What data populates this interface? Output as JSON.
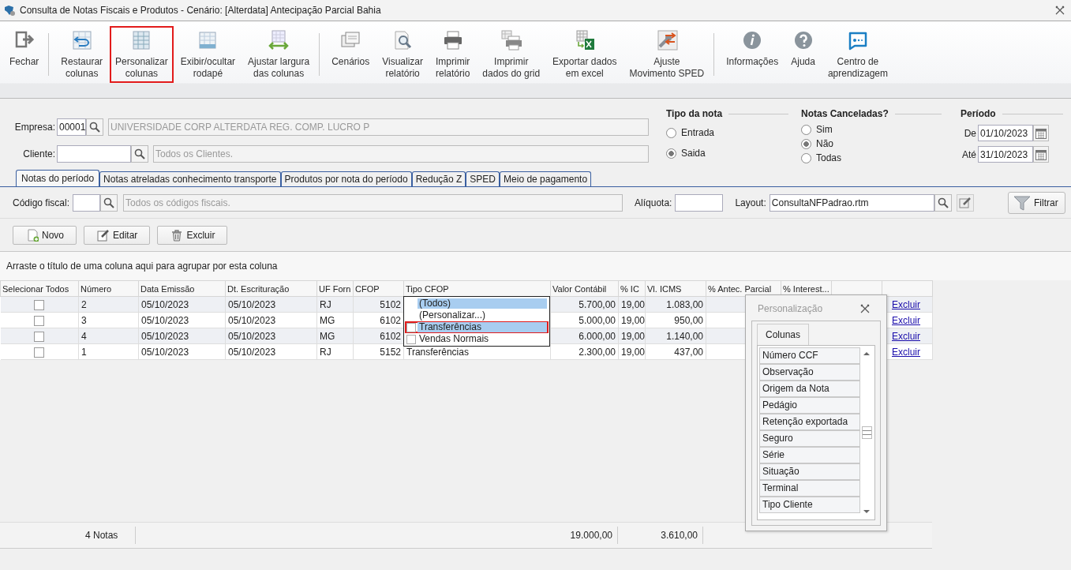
{
  "window": {
    "title": "Consulta de Notas Fiscais e Produtos - Cenário: [Alterdata] Antecipação Parcial Bahia"
  },
  "toolbar": [
    {
      "label": "Fechar",
      "highlighted": false,
      "separator_after": true
    },
    {
      "label": "Restaurar\ncolunas",
      "highlighted": false,
      "separator_after": false
    },
    {
      "label": "Personalizar\ncolunas",
      "highlighted": true,
      "separator_after": false
    },
    {
      "label": "Exibir/ocultar\nrodapé",
      "highlighted": false,
      "separator_after": false
    },
    {
      "label": "Ajustar largura\ndas colunas",
      "highlighted": false,
      "separator_after": true
    },
    {
      "label": "Cenários",
      "highlighted": false,
      "separator_after": false
    },
    {
      "label": "Visualizar\nrelatório",
      "highlighted": false,
      "separator_after": false
    },
    {
      "label": "Imprimir\nrelatório",
      "highlighted": false,
      "separator_after": false
    },
    {
      "label": "Imprimir\ndados do grid",
      "highlighted": false,
      "separator_after": false
    },
    {
      "label": "Exportar dados\nem excel",
      "highlighted": false,
      "separator_after": false
    },
    {
      "label": "Ajuste\nMovimento SPED",
      "highlighted": false,
      "separator_after": true
    },
    {
      "label": "Informações",
      "highlighted": false,
      "separator_after": false
    },
    {
      "label": "Ajuda",
      "highlighted": false,
      "separator_after": false
    },
    {
      "label": "Centro de\naprendizagem",
      "highlighted": false,
      "separator_after": false
    }
  ],
  "empresa": {
    "label": "Empresa:",
    "code": "00001",
    "name": "UNIVERSIDADE CORP ALTERDATA REG. COMP. LUCRO P"
  },
  "cliente": {
    "label": "Cliente:",
    "placeholder": "Todos os Clientes."
  },
  "tipo_da_nota": {
    "title": "Tipo da nota",
    "options": [
      {
        "label": "Entrada",
        "selected": false
      },
      {
        "label": "Saida",
        "selected": true
      }
    ]
  },
  "notas_canceladas": {
    "title": "Notas Canceladas?",
    "options": [
      {
        "label": "Sim",
        "selected": false
      },
      {
        "label": "Não",
        "selected": true
      },
      {
        "label": "Todas",
        "selected": false
      }
    ]
  },
  "periodo": {
    "title": "Período",
    "dates": [
      {
        "label": "De",
        "value": "01/10/2023"
      },
      {
        "label": "Até",
        "value": "31/10/2023"
      }
    ]
  },
  "tabs": [
    {
      "label": "Notas do período",
      "selected": true
    },
    {
      "label": "Notas atreladas conhecimento transporte",
      "selected": false
    },
    {
      "label": "Produtos por nota do período",
      "selected": false
    },
    {
      "label": "Redução Z",
      "selected": false
    },
    {
      "label": "SPED",
      "selected": false
    },
    {
      "label": "Meio de pagamento",
      "selected": false
    }
  ],
  "codigo_fiscal": {
    "label": "Código fiscal:",
    "placeholder": "Todos os códigos fiscais."
  },
  "aliquota": {
    "label": "Alíquota:"
  },
  "layout": {
    "label": "Layout:",
    "value": "ConsultaNFPadrao.rtm"
  },
  "filter_button": "Filtrar",
  "actions": [
    "Novo",
    "Editar",
    "Excluir"
  ],
  "group_hint": "Arraste o título de uma coluna aqui para agrupar por esta coluna",
  "table": {
    "columns": [
      "Selecionar Todos",
      "Número",
      "Data Emissão",
      "Dt. Escrituração",
      "UF Forn",
      "CFOP",
      "Tipo CFOP",
      "Valor Contábil",
      "% IC",
      "Vl. ICMS",
      "% Antec. Parcial",
      "% Interest..."
    ],
    "rows": [
      {
        "checked": false,
        "numero": "2",
        "data_emissao": "05/10/2023",
        "dt_escrituracao": "05/10/2023",
        "uf": "RJ",
        "cfop": "5102",
        "valor_contabil": "5.700,00",
        "pct_icms": "19,00",
        "vl_icms": "1.083,00",
        "action": "Excluir"
      },
      {
        "checked": false,
        "numero": "3",
        "data_emissao": "05/10/2023",
        "dt_escrituracao": "05/10/2023",
        "uf": "MG",
        "cfop": "6102",
        "valor_contabil": "5.000,00",
        "pct_icms": "19,00",
        "vl_icms": "950,00",
        "action": "Excluir"
      },
      {
        "checked": false,
        "numero": "4",
        "data_emissao": "05/10/2023",
        "dt_escrituracao": "05/10/2023",
        "uf": "MG",
        "cfop": "6102",
        "valor_contabil": "6.000,00",
        "pct_icms": "19,00",
        "vl_icms": "1.140,00",
        "action": "Excluir"
      },
      {
        "checked": false,
        "numero": "1",
        "data_emissao": "05/10/2023",
        "dt_escrituracao": "05/10/2023",
        "uf": "RJ",
        "cfop": "5152",
        "tipo_cfop": "Transferências",
        "valor_contabil": "2.300,00",
        "pct_icms": "19,00",
        "vl_icms": "437,00",
        "action": "Excluir"
      }
    ],
    "footer": {
      "count": "4 Notas",
      "valor_contabil": "19.000,00",
      "vl_icms": "3.610,00"
    }
  },
  "filter_dropdown": {
    "items": [
      {
        "label": "(Todos)",
        "kind": "plain",
        "selected": true,
        "highlighted": false
      },
      {
        "label": "(Personalizar...)",
        "kind": "plain",
        "selected": false,
        "highlighted": false
      },
      {
        "label": "Transferências",
        "kind": "check",
        "checked": false,
        "selected": true,
        "highlighted": true
      },
      {
        "label": "Vendas Normais",
        "kind": "check",
        "checked": false,
        "selected": false,
        "highlighted": false
      }
    ]
  },
  "personalizacao": {
    "title": "Personalização",
    "tab": "Colunas",
    "items": [
      "Número CCF",
      "Observação",
      "Origem da Nota",
      "Pedágio",
      "Retenção exportada",
      "Seguro",
      "Série",
      "Situação",
      "Terminal",
      "Tipo Cliente"
    ]
  }
}
